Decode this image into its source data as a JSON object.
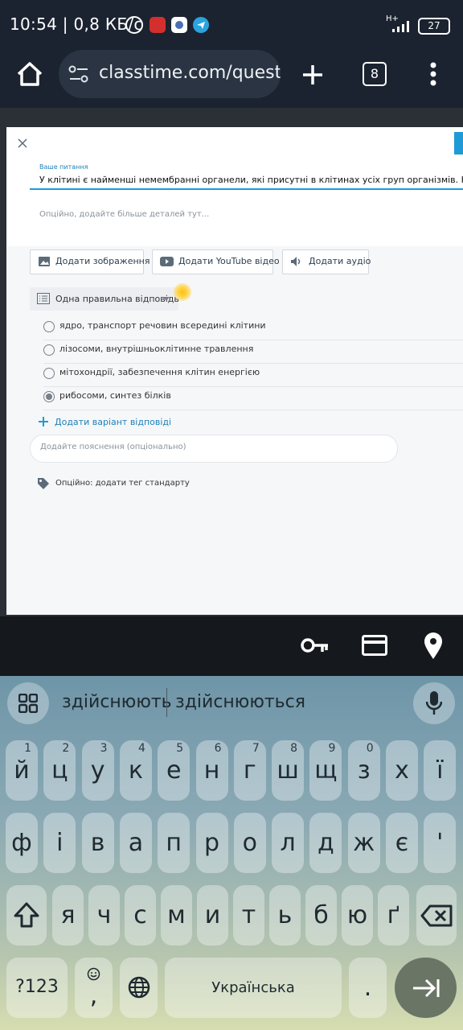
{
  "status_bar": {
    "time": "10:54",
    "speed": "0,8 КБ/с",
    "network_type": "H+",
    "battery": "27"
  },
  "browser": {
    "url": "classtime.com/quest",
    "tab_count": "8"
  },
  "editor": {
    "question_label": "Ваше питання",
    "question_text": "У клітині є найменші немембранні органели, які присутні в клітинах усіх груп організмів. Назвіть",
    "details_placeholder": "Опційно, додайте більше деталей тут...",
    "add_image": "Додати зображення",
    "add_youtube": "Додати YouTube відео",
    "add_audio": "Додати аудіо",
    "answer_type": "Одна правильна відповідь",
    "options": [
      {
        "text": "ядро, транспорт речовин всередині клітини",
        "selected": false
      },
      {
        "text": "лізосоми, внутрішньоклітинне травлення",
        "selected": false
      },
      {
        "text": "мітохондрії, забезпечення клітин енергією",
        "selected": false
      },
      {
        "text": "рибосоми, синтез білків",
        "selected": true
      }
    ],
    "add_option": "Додати варіант відповіді",
    "explanation_placeholder": "Додайте пояснення (опціонально)",
    "standard_tag": "Опційно: додати тег стандарту"
  },
  "keyboard": {
    "suggestions": [
      "здійснюють",
      "здійснюються"
    ],
    "row1": [
      {
        "k": "й",
        "h": "1"
      },
      {
        "k": "ц",
        "h": "2"
      },
      {
        "k": "у",
        "h": "3"
      },
      {
        "k": "к",
        "h": "4"
      },
      {
        "k": "е",
        "h": "5"
      },
      {
        "k": "н",
        "h": "6"
      },
      {
        "k": "г",
        "h": "7"
      },
      {
        "k": "ш",
        "h": "8"
      },
      {
        "k": "щ",
        "h": "9"
      },
      {
        "k": "з",
        "h": "0"
      },
      {
        "k": "х",
        "h": ""
      },
      {
        "k": "ї",
        "h": ""
      }
    ],
    "row2": [
      "ф",
      "і",
      "в",
      "а",
      "п",
      "р",
      "о",
      "л",
      "д",
      "ж",
      "є",
      "'"
    ],
    "row3": [
      "я",
      "ч",
      "с",
      "м",
      "и",
      "т",
      "ь",
      "б",
      "ю",
      "ґ"
    ],
    "symbols_key": "?123",
    "comma_key": ",",
    "space_label": "Українська",
    "period_key": "."
  },
  "colors": {
    "accent": "#1e9bd7",
    "status_bg": "#1b2330",
    "keyboard_top": "#6e95a8",
    "keyboard_bottom": "#d6ddb0"
  }
}
